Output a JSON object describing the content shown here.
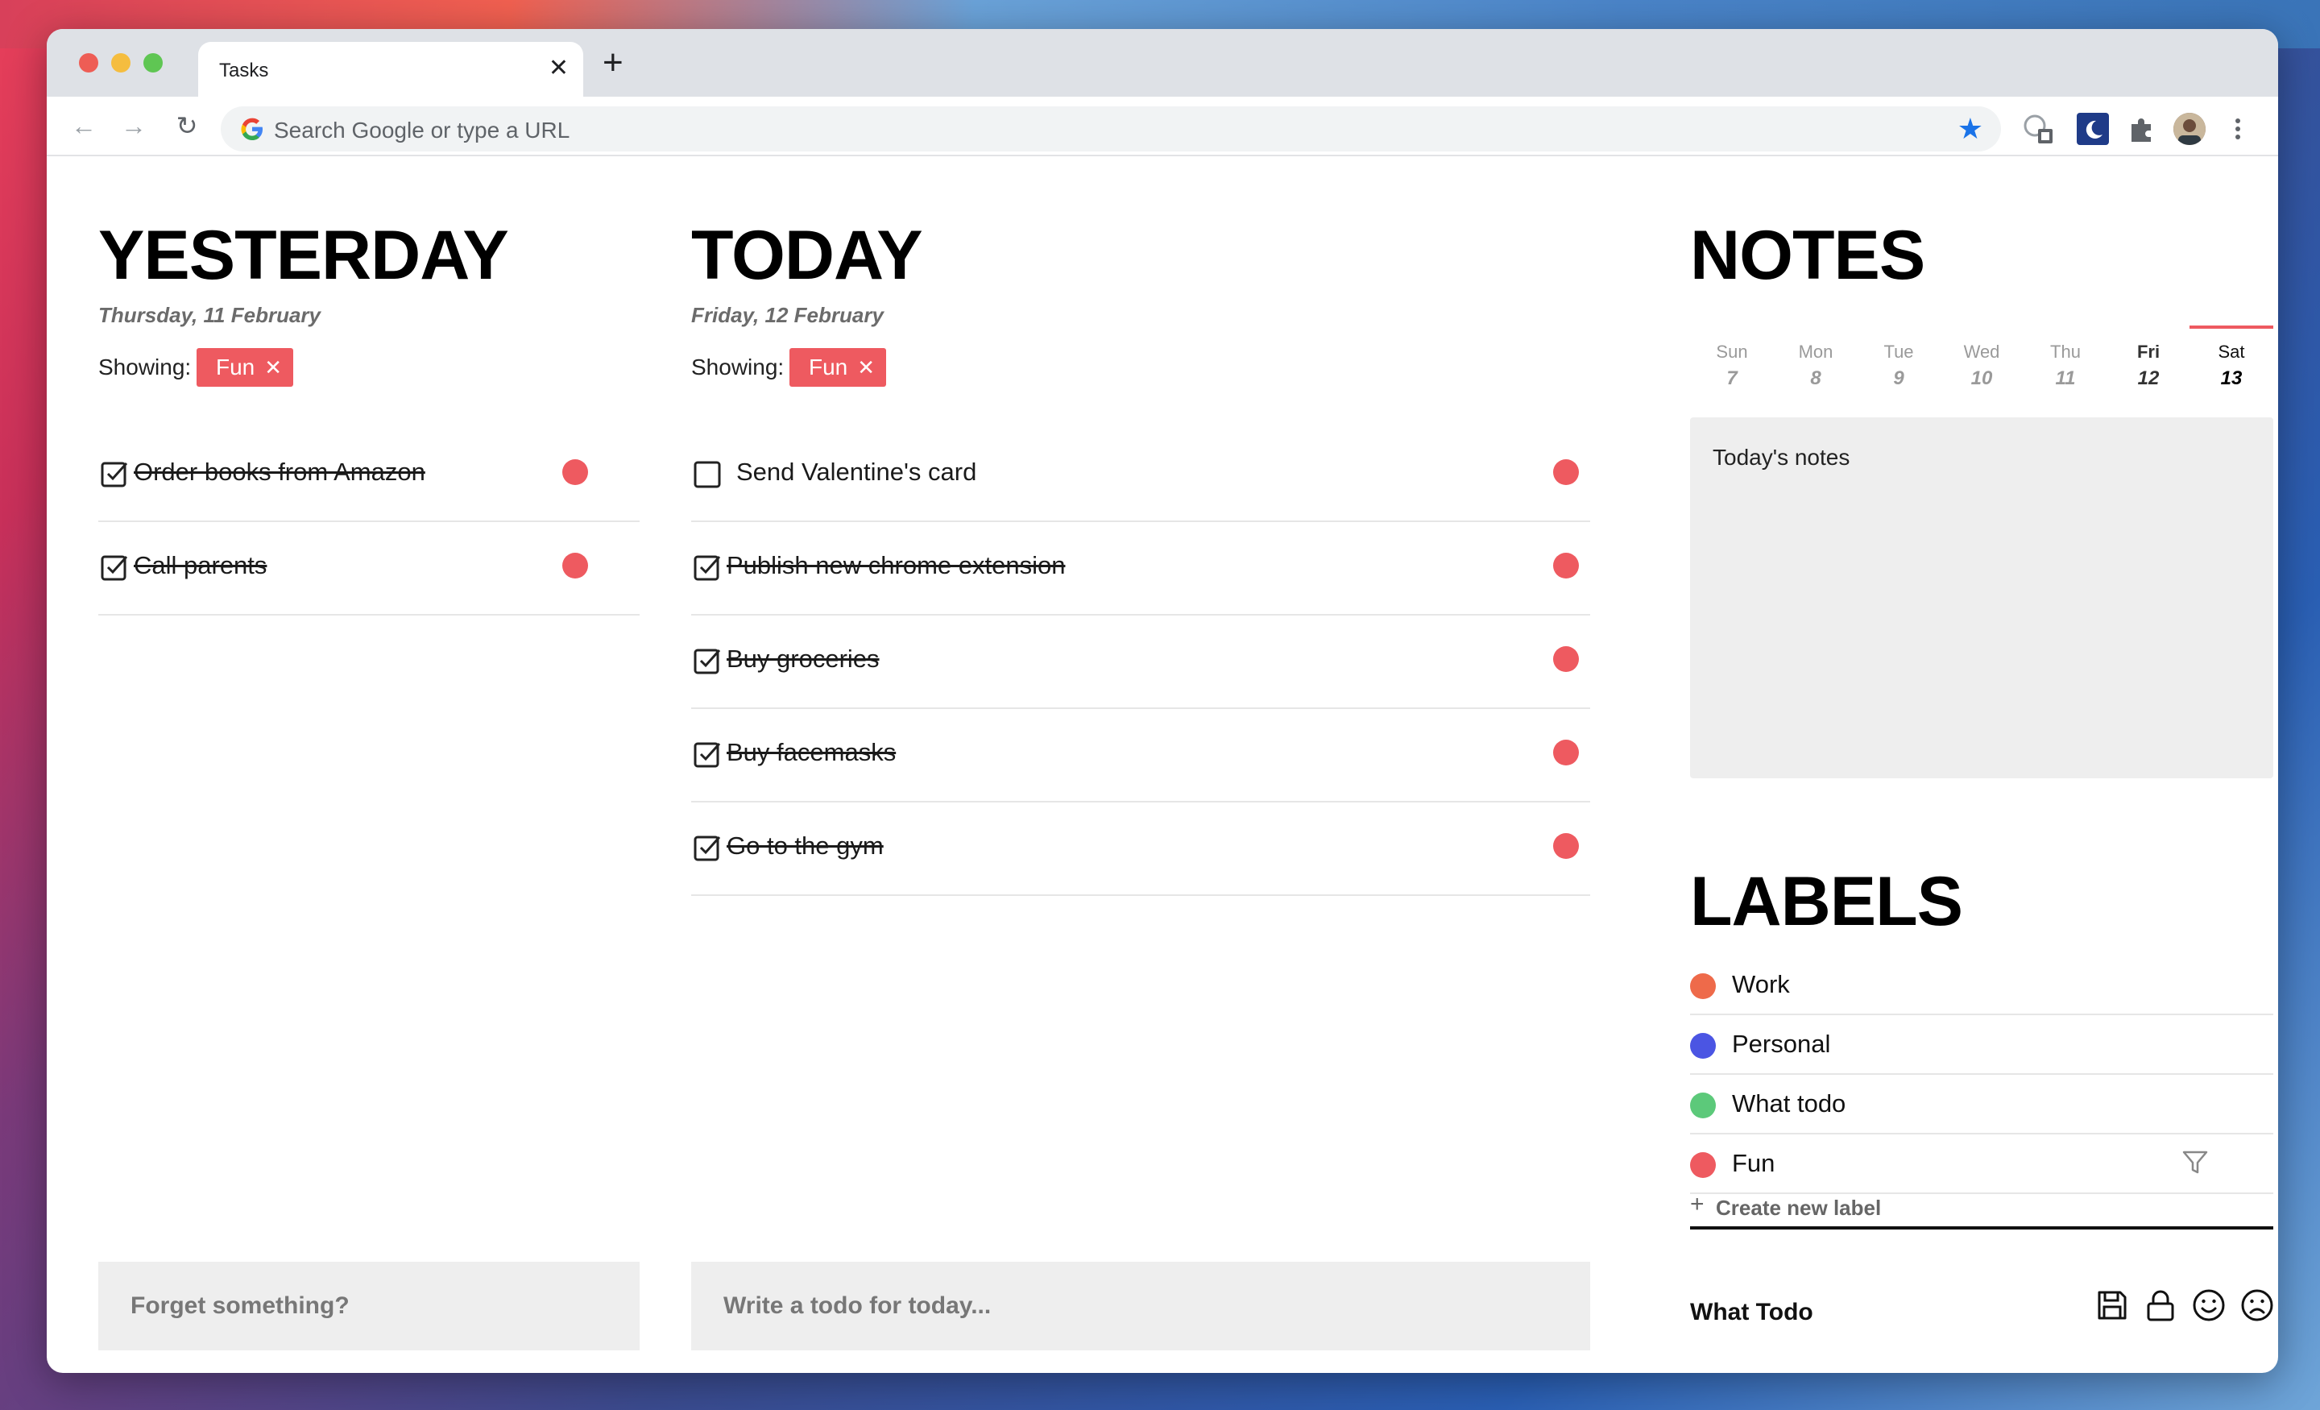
{
  "browser": {
    "tab_title": "Tasks",
    "tab_close": "✕",
    "new_tab": "+",
    "omnibox_placeholder": "Search Google or type a URL",
    "omnibox_star": "★"
  },
  "yesterday": {
    "title": "YESTERDAY",
    "date": "Thursday, 11 February",
    "showing_label": "Showing:",
    "filter_chip": "Fun",
    "chip_close": "✕",
    "todos": [
      {
        "text": "Order books from Amazon",
        "done": true
      },
      {
        "text": "Call parents",
        "done": true
      }
    ],
    "input_placeholder": "Forget something?"
  },
  "today": {
    "title": "TODAY",
    "date": "Friday, 12 February",
    "showing_label": "Showing:",
    "filter_chip": "Fun",
    "chip_close": "✕",
    "todos": [
      {
        "text": "Send Valentine's card",
        "done": false
      },
      {
        "text": "Publish new chrome extension",
        "done": true
      },
      {
        "text": "Buy groceries",
        "done": true
      },
      {
        "text": "Buy facemasks",
        "done": true
      },
      {
        "text": "Go to the gym",
        "done": true
      }
    ],
    "input_placeholder": "Write a todo for today..."
  },
  "notes": {
    "title": "NOTES",
    "week": [
      {
        "day": "Sun",
        "date": "7"
      },
      {
        "day": "Mon",
        "date": "8"
      },
      {
        "day": "Tue",
        "date": "9"
      },
      {
        "day": "Wed",
        "date": "10"
      },
      {
        "day": "Thu",
        "date": "11"
      },
      {
        "day": "Fri",
        "date": "12"
      },
      {
        "day": "Sat",
        "date": "13"
      }
    ],
    "active_day": "Sat",
    "notes_placeholder": "Today's notes"
  },
  "labels": {
    "title": "LABELS",
    "items": [
      {
        "name": "Work",
        "color": "#ee6a4a"
      },
      {
        "name": "Personal",
        "color": "#4b55e3"
      },
      {
        "name": "What todo",
        "color": "#5cc97a"
      },
      {
        "name": "Fun",
        "color": "#ee5a60"
      }
    ],
    "create_plus": "+",
    "create_label": "Create new label"
  },
  "footer": {
    "brand": "What Todo"
  },
  "colors": {
    "accent": "#ee5a60",
    "panel": "#eeeeee"
  }
}
